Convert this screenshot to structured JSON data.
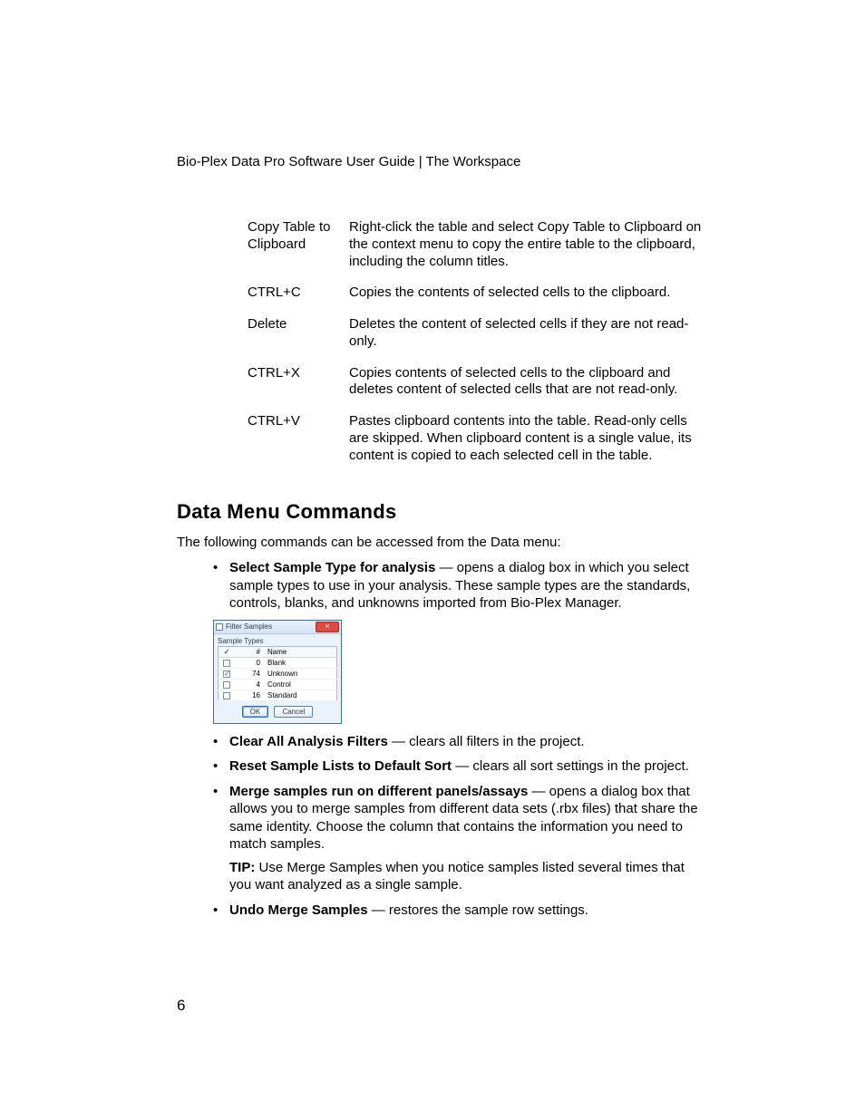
{
  "header": "Bio-Plex Data Pro Software User Guide | The Workspace",
  "shortcuts": [
    {
      "key": "Copy Table to Clipboard",
      "desc": "Right-click the table and select Copy Table to Clipboard on the context menu to copy the entire table to the clipboard, including the column titles."
    },
    {
      "key": "CTRL+C",
      "desc": "Copies the contents of selected cells to the clipboard."
    },
    {
      "key": "Delete",
      "desc": "Deletes the content of selected cells if they are not read-only."
    },
    {
      "key": "CTRL+X",
      "desc": "Copies contents of selected cells to the clipboard and deletes content of selected cells that are not read-only."
    },
    {
      "key": "CTRL+V",
      "desc": "Pastes clipboard contents into the table. Read-only cells are skipped. When clipboard content is a single value, its content is copied to each selected cell in the table."
    }
  ],
  "section_heading": "Data Menu Commands",
  "intro": "The following commands can be accessed from the Data menu:",
  "bullets": {
    "select_sample_type": {
      "term": "Select Sample Type for analysis",
      "desc": " — opens a dialog box in which you select sample types to use in your analysis. These sample types are the standards, controls, blanks, and unknowns imported from Bio-Plex Manager."
    },
    "clear_filters": {
      "term": "Clear All Analysis Filters",
      "desc": " — clears all filters in the project."
    },
    "reset_sort": {
      "term": "Reset Sample Lists to Default Sort",
      "desc": " — clears all sort settings in the project."
    },
    "merge": {
      "term": "Merge samples run on different panels/assays",
      "desc": " — opens a dialog box that allows you to merge samples from different data sets (.rbx files) that share the same identity. Choose the column that contains the information you need to match samples.",
      "tip_label": "TIP:",
      "tip": " Use Merge Samples when you notice samples listed several times that you want analyzed as a single sample."
    },
    "undo_merge": {
      "term": "Undo Merge Samples",
      "desc": " — restores the sample row settings."
    }
  },
  "dialog": {
    "title": "Filter Samples",
    "section_label": "Sample Types",
    "headers": {
      "check": "✓",
      "count": "#",
      "name": "Name"
    },
    "rows": [
      {
        "checked": false,
        "count": "0",
        "name": "Blank"
      },
      {
        "checked": true,
        "count": "74",
        "name": "Unknown"
      },
      {
        "checked": false,
        "count": "4",
        "name": "Control"
      },
      {
        "checked": false,
        "count": "16",
        "name": "Standard"
      }
    ],
    "ok": "OK",
    "cancel": "Cancel"
  },
  "page_number": "6"
}
